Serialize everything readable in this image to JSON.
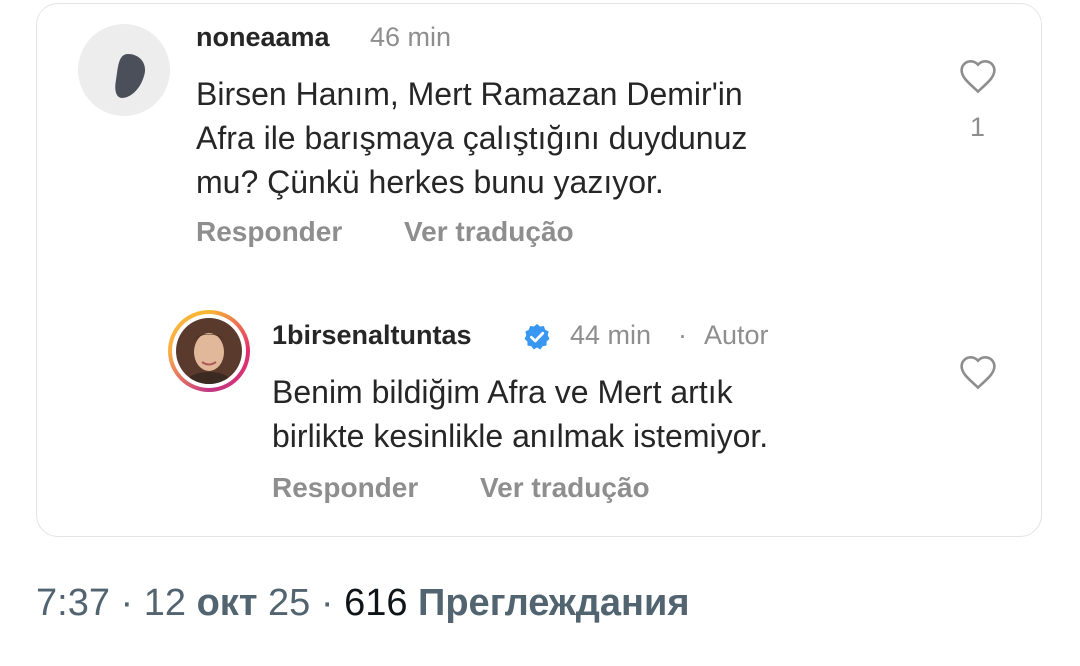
{
  "comment": {
    "username": "noneaama",
    "time": "46 min",
    "text_lines": [
      "Birsen Hanım, Mert Ramazan Demir'in",
      "Afra ile barışmaya çalıştığını duydunuz",
      "mu? Çünkü herkes bunu yazıyor."
    ],
    "likes": "1",
    "reply_label": "Responder",
    "translate_label": "Ver tradução"
  },
  "reply": {
    "username": "1birsenaltuntas",
    "time": "44 min",
    "separator": "·",
    "author_label": "Autor",
    "text_lines": [
      "Benim bildiğim Afra ve Mert artık",
      "birlikte kesinlikle anılmak istemiyor."
    ],
    "reply_label": "Responder",
    "translate_label": "Ver tradução"
  },
  "tweet_meta": {
    "time": "7:37",
    "sep1": "·",
    "date_day": "12",
    "date_month": "окт",
    "date_year": "25",
    "sep2": "·",
    "views_count": "616",
    "views_label": "Преглеждания"
  },
  "colors": {
    "verified": "#3897f0",
    "text": "#262626",
    "muted": "#8e8e8e"
  }
}
